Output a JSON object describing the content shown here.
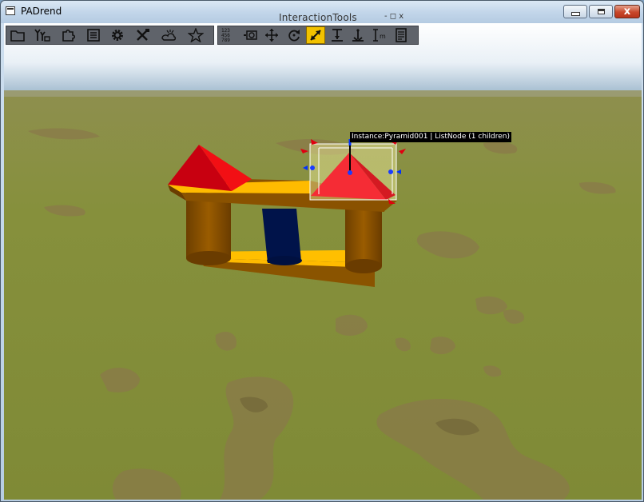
{
  "window": {
    "title": "PADrend",
    "minimize_label": "minimize",
    "maximize_label": "maximize",
    "close_glyph": "x"
  },
  "floating_panel": {
    "title": "InteractionTools",
    "controls": "- ◻ x"
  },
  "toolbar_main": [
    {
      "icon": "folder-icon"
    },
    {
      "icon": "scene-tree-icon"
    },
    {
      "icon": "puzzle-icon"
    },
    {
      "icon": "list-icon"
    },
    {
      "icon": "gear-icon"
    },
    {
      "icon": "tools-icon"
    },
    {
      "icon": "weather-icon"
    },
    {
      "icon": "star-icon"
    }
  ],
  "toolbar_interaction": [
    {
      "icon": "numbers-icon",
      "label": "123\n456\n789"
    },
    {
      "icon": "camera-icon"
    },
    {
      "icon": "move-icon"
    },
    {
      "icon": "rotate-icon"
    },
    {
      "icon": "scale-icon",
      "active": true
    },
    {
      "icon": "snap-down-icon"
    },
    {
      "icon": "anchor-icon"
    },
    {
      "icon": "measure-icon"
    },
    {
      "icon": "notes-icon"
    }
  ],
  "tooltip": {
    "text": "Instance:Pyramid001 | ListNode (1 children)"
  },
  "colors": {
    "sky_top": "#ffffff",
    "sky_bottom": "#9fb9cd",
    "grass": "#8a8f3c",
    "wood_brown": "#8a5200",
    "plank_yellow": "#ffbb00",
    "pyramid_red": "#e8000c",
    "pillar_navy": "#00134a",
    "active_tool": "#f2c200"
  }
}
